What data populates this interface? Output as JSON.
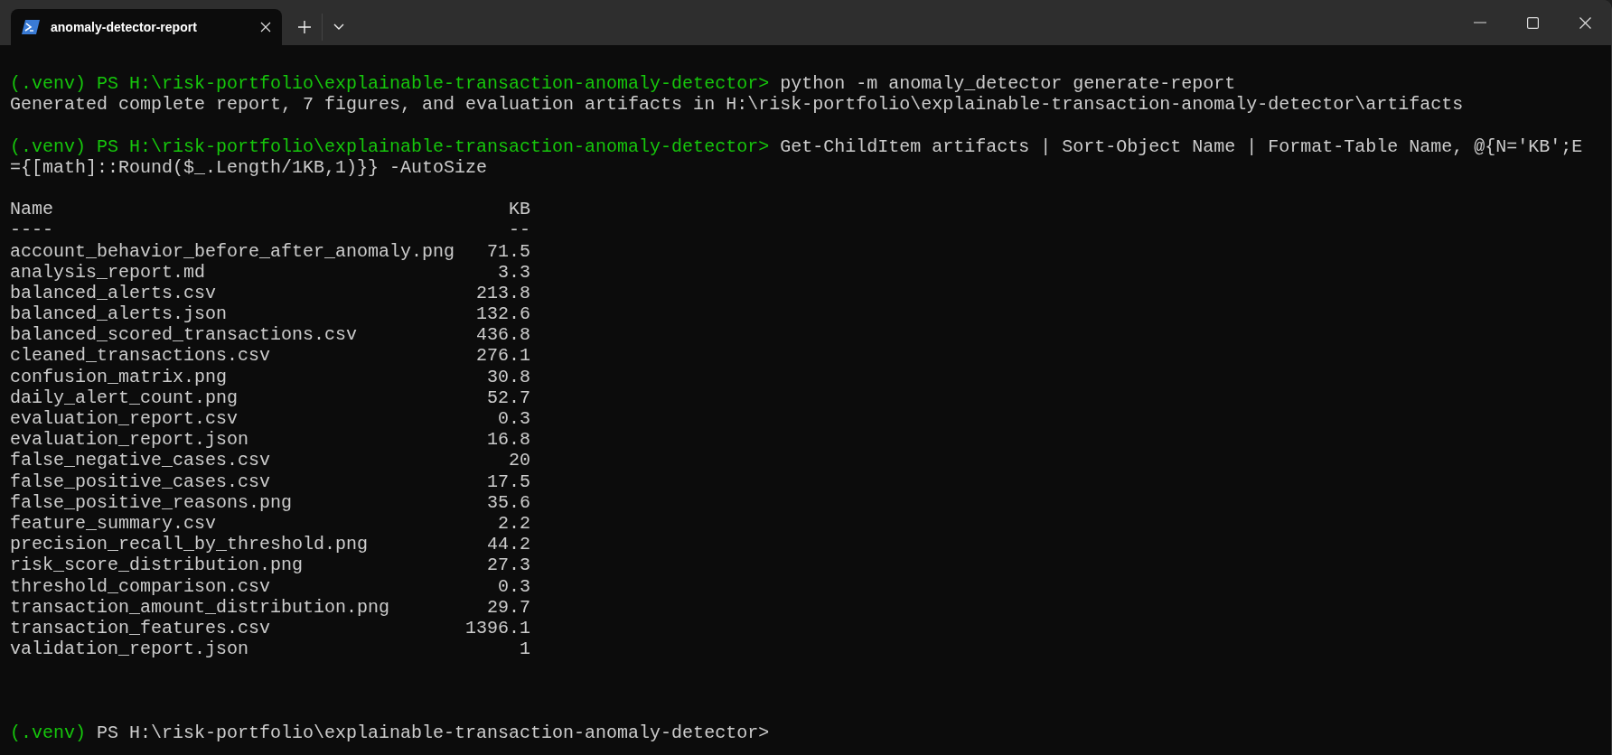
{
  "tabs": [
    {
      "title": "anomaly-detector-report",
      "selected": true
    }
  ],
  "terminal": {
    "blocks": [
      {
        "prompt": {
          "env": "(.venv)",
          "path": "PS H:\\risk-portfolio\\explainable-transaction-anomaly-detector>",
          "path_highlighted": true
        },
        "command_lines": [
          "python -m anomaly_detector generate-report"
        ],
        "output": [
          "Generated complete report, 7 figures, and evaluation artifacts in H:\\risk-portfolio\\explainable-transaction-anomaly-detector\\artifacts"
        ]
      },
      {
        "prompt": {
          "env": "(.venv)",
          "path": "PS H:\\risk-portfolio\\explainable-transaction-anomaly-detector>",
          "path_highlighted": true
        },
        "command_lines": [
          "Get-ChildItem artifacts | Sort-Object Name | Format-Table Name, @{N='KB';E",
          "={[math]::Round($_.Length/1KB,1)}} -AutoSize"
        ]
      }
    ],
    "table": {
      "columns": [
        "Name",
        "KB"
      ],
      "underlines": [
        "----",
        "--"
      ],
      "rows": [
        {
          "name": "account_behavior_before_after_anomaly.png",
          "kb": "71.5"
        },
        {
          "name": "analysis_report.md",
          "kb": "3.3"
        },
        {
          "name": "balanced_alerts.csv",
          "kb": "213.8"
        },
        {
          "name": "balanced_alerts.json",
          "kb": "132.6"
        },
        {
          "name": "balanced_scored_transactions.csv",
          "kb": "436.8"
        },
        {
          "name": "cleaned_transactions.csv",
          "kb": "276.1"
        },
        {
          "name": "confusion_matrix.png",
          "kb": "30.8"
        },
        {
          "name": "daily_alert_count.png",
          "kb": "52.7"
        },
        {
          "name": "evaluation_report.csv",
          "kb": "0.3"
        },
        {
          "name": "evaluation_report.json",
          "kb": "16.8"
        },
        {
          "name": "false_negative_cases.csv",
          "kb": "20"
        },
        {
          "name": "false_positive_cases.csv",
          "kb": "17.5"
        },
        {
          "name": "false_positive_reasons.png",
          "kb": "35.6"
        },
        {
          "name": "feature_summary.csv",
          "kb": "2.2"
        },
        {
          "name": "precision_recall_by_threshold.png",
          "kb": "44.2"
        },
        {
          "name": "risk_score_distribution.png",
          "kb": "27.3"
        },
        {
          "name": "threshold_comparison.csv",
          "kb": "0.3"
        },
        {
          "name": "transaction_amount_distribution.png",
          "kb": "29.7"
        },
        {
          "name": "transaction_features.csv",
          "kb": "1396.1"
        },
        {
          "name": "validation_report.json",
          "kb": "1"
        }
      ]
    },
    "final_prompt": {
      "env": "(.venv)",
      "path": "PS H:\\risk-portfolio\\explainable-transaction-anomaly-detector>",
      "path_highlighted": false
    }
  }
}
